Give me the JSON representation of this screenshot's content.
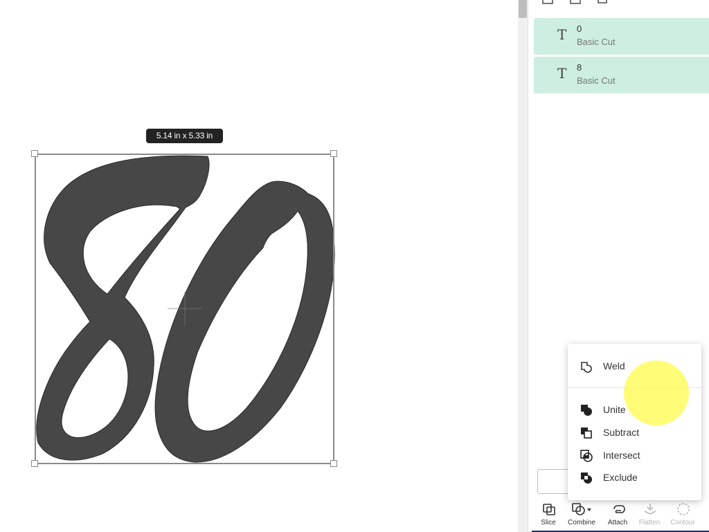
{
  "canvas": {
    "size_label": "5.14  in x 5.33  in",
    "artwork_text": "80"
  },
  "layers": [
    {
      "name": "0",
      "type": "Basic Cut",
      "icon": "text-layer-icon"
    },
    {
      "name": "8",
      "type": "Basic Cut",
      "icon": "text-layer-icon"
    }
  ],
  "combine_menu": {
    "items": [
      {
        "label": "Weld",
        "icon": "weld-icon"
      },
      {
        "label": "Unite",
        "icon": "unite-icon"
      },
      {
        "label": "Subtract",
        "icon": "subtract-icon"
      },
      {
        "label": "Intersect",
        "icon": "intersect-icon"
      },
      {
        "label": "Exclude",
        "icon": "exclude-icon"
      }
    ]
  },
  "toolbar": {
    "items": [
      {
        "label": "Slice",
        "icon": "slice-icon",
        "enabled": true
      },
      {
        "label": "Combine",
        "icon": "combine-icon",
        "enabled": true
      },
      {
        "label": "Attach",
        "icon": "attach-icon",
        "enabled": true
      },
      {
        "label": "Flatten",
        "icon": "flatten-icon",
        "enabled": false
      },
      {
        "label": "Contour",
        "icon": "contour-icon",
        "enabled": false
      }
    ]
  },
  "colors": {
    "layer_bg": "#cdeee0",
    "artwork_fill": "#474747",
    "toolbar_accent": "#1e2a78",
    "cursor_highlight": "#fffc5a"
  }
}
